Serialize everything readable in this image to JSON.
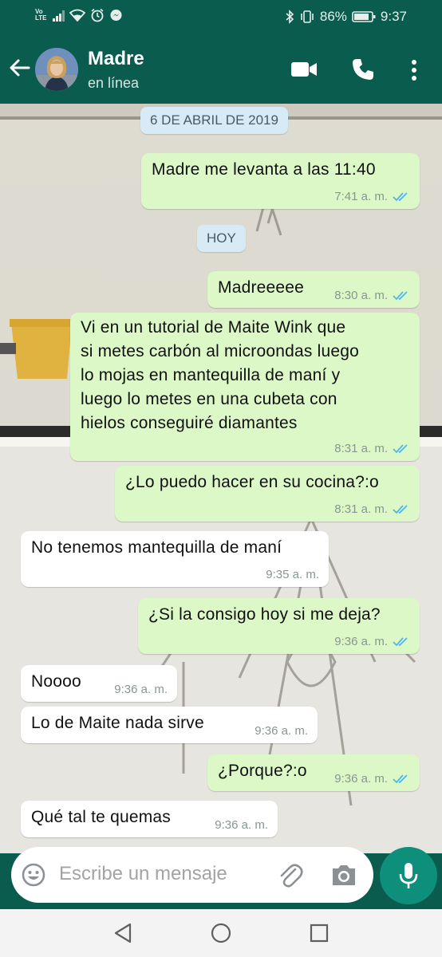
{
  "status_bar": {
    "volte": "Vo LTE",
    "battery_percent": "86%",
    "time": "9:37"
  },
  "header": {
    "contact_name": "Madre",
    "contact_status": "en línea"
  },
  "date_chips": {
    "first": "6 DE ABRIL DE 2019",
    "second": "HOY"
  },
  "messages": [
    {
      "direction": "out",
      "text": "Madre me levanta a las 11:40",
      "time": "7:41 a. m.",
      "read": true
    },
    {
      "direction": "out",
      "text": "Madreeeee",
      "time": "8:30 a. m.",
      "read": true
    },
    {
      "direction": "out",
      "lines": [
        "Vi en un tutorial de Maite Wink que",
        "si metes carbón al microondas luego",
        "lo mojas en mantequilla de maní y",
        "luego lo metes en una cubeta con",
        "hielos conseguiré diamantes"
      ],
      "time": "8:31 a. m.",
      "read": true
    },
    {
      "direction": "out",
      "text": "¿Lo puedo hacer en su cocina?:o",
      "time": "8:31 a. m.",
      "read": true
    },
    {
      "direction": "in",
      "text": "No tenemos mantequilla de maní",
      "time": "9:35 a. m."
    },
    {
      "direction": "out",
      "text": "¿Si la consigo hoy si me deja?",
      "time": "9:36 a. m.",
      "read": true
    },
    {
      "direction": "in",
      "text": "Noooo",
      "time": "9:36 a. m."
    },
    {
      "direction": "in",
      "text": "Lo de Maite nada sirve",
      "time": "9:36 a. m."
    },
    {
      "direction": "out",
      "text": "¿Porque?:o",
      "time": "9:36 a. m.",
      "read": true
    },
    {
      "direction": "in",
      "text": "Qué tal te quemas",
      "time": "9:36 a. m."
    }
  ],
  "composer": {
    "placeholder": "Escribe un mensaje"
  },
  "colors": {
    "header": "#0a5c4f",
    "outgoing_bubble": "#dcf8c6",
    "incoming_bubble": "#ffffff",
    "read_ticks": "#4fb6ec",
    "mic_button": "#0e8f7c"
  },
  "icons": [
    "back-arrow-icon",
    "video-call-icon",
    "phone-icon",
    "more-vert-icon",
    "emoji-icon",
    "attach-icon",
    "camera-icon",
    "mic-icon",
    "nav-back-icon",
    "nav-home-icon",
    "nav-recents-icon"
  ]
}
